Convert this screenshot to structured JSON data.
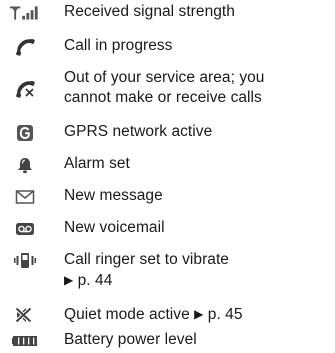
{
  "items": [
    {
      "icon": "signal-strength-icon",
      "lines": [
        "Received signal strength"
      ]
    },
    {
      "icon": "call-in-progress-icon",
      "lines": [
        "Call in progress"
      ]
    },
    {
      "icon": "out-of-service-icon",
      "lines": [
        "Out of your service area; you",
        "cannot make or receive calls"
      ]
    },
    {
      "icon": "gprs-icon",
      "lines": [
        "GPRS network active"
      ]
    },
    {
      "icon": "alarm-icon",
      "lines": [
        "Alarm set"
      ]
    },
    {
      "icon": "new-message-icon",
      "lines": [
        "New message"
      ]
    },
    {
      "icon": "voicemail-icon",
      "lines": [
        "New voicemail"
      ]
    },
    {
      "icon": "vibrate-icon",
      "lines": [
        "Call ringer set to vibrate"
      ],
      "ref_arrow": "▶",
      "ref_text": "p. 44"
    },
    {
      "icon": "quiet-mode-icon",
      "lines": [
        "Quiet mode active"
      ],
      "ref_arrow": "▶",
      "ref_text": "p. 45"
    },
    {
      "icon": "battery-icon",
      "lines": [
        "Battery power level"
      ]
    }
  ]
}
